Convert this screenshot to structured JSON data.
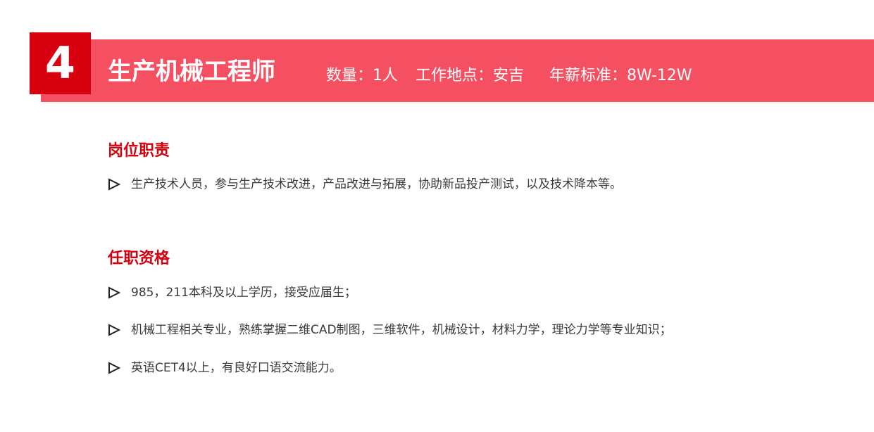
{
  "job": {
    "number": "4",
    "title": "生产机械工程师",
    "quantity": "数量：1人",
    "location": "工作地点：安吉",
    "salary": "年薪标准：8W-12W"
  },
  "duties": {
    "heading": "岗位职责",
    "items": [
      "生产技术人员，参与生产技术改进，产品改进与拓展，协助新品投产测试，以及技术降本等。"
    ]
  },
  "requirements": {
    "heading": "任职资格",
    "items": [
      "985，211本科及以上学历，接受应届生；",
      "机械工程相关专业，熟练掌握二维CAD制图，三维软件，机械设计，材料力学，理论力学等专业知识；",
      "英语CET4以上，有良好口语交流能力。"
    ]
  },
  "colors": {
    "banner": "#f55062",
    "number_box": "#d7000f",
    "heading": "#d7000f"
  },
  "icons": {
    "bullet": "play-triangle-outline-icon"
  }
}
